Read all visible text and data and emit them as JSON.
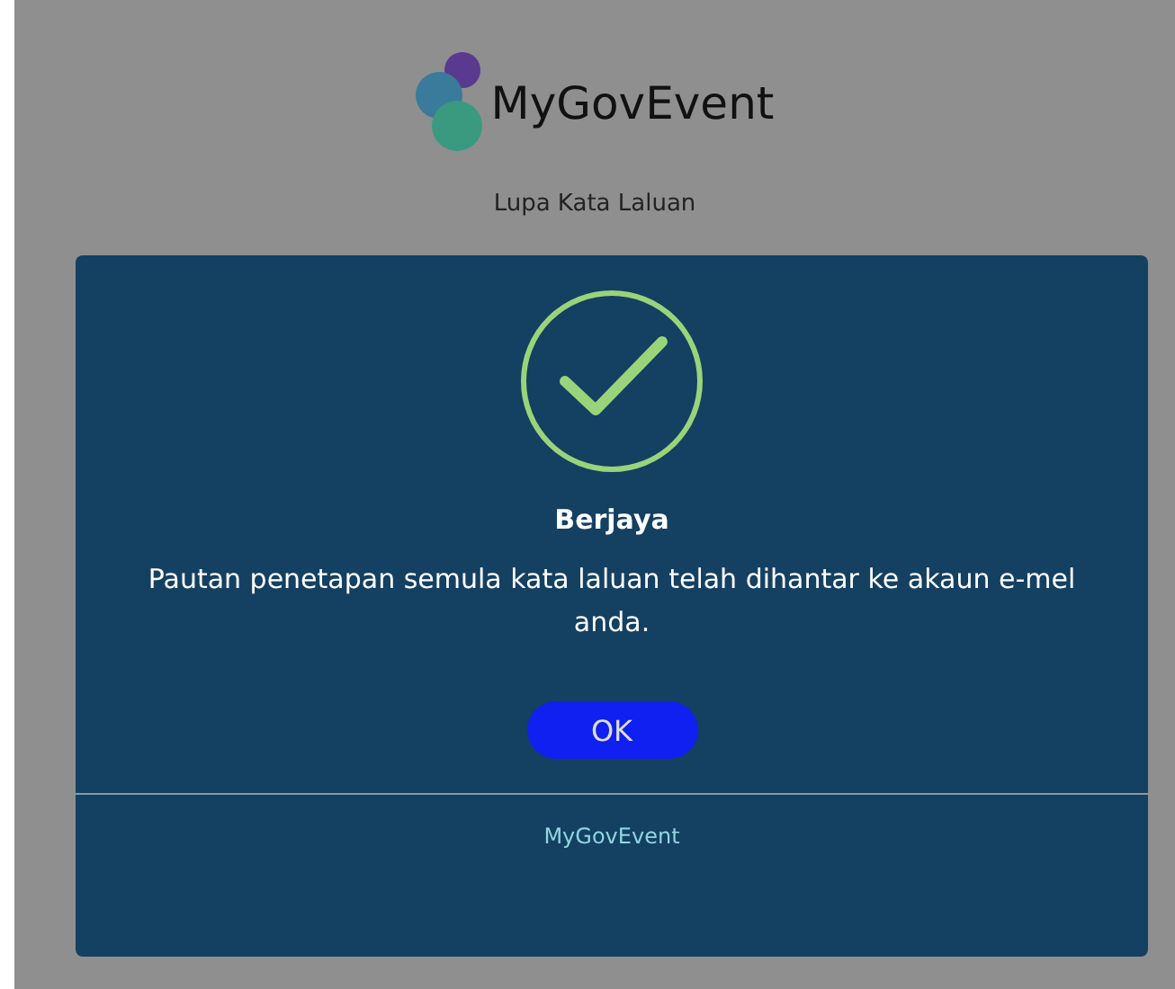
{
  "page": {
    "logo": "MyGovEvent",
    "title": "Lupa Kata Laluan"
  },
  "dialog": {
    "title": "Berjaya",
    "message": "Pautan penetapan semula kata laluan telah dihantar ke akaun e-mel anda.",
    "ok": "OK",
    "footer": "MyGovEvent"
  }
}
